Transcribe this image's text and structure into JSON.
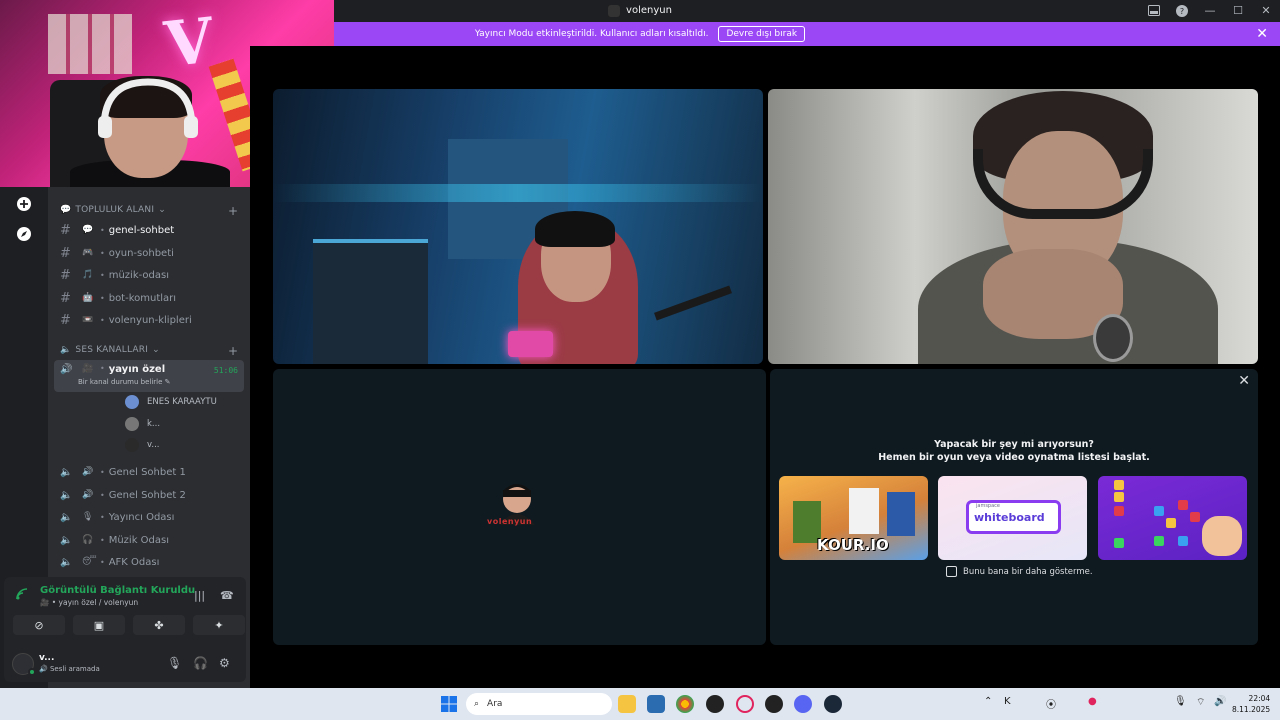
{
  "window": {
    "title": "volenyun"
  },
  "notice": {
    "text": "Yayıncı Modu etkinleştirildi. Kullanıcı adları kısaltıldı.",
    "button": "Devre dışı bırak"
  },
  "sidebar": {
    "text_category": "TOPLULUK ALANI",
    "text_channels": [
      {
        "emoji": "💬",
        "name": "genel-sohbet",
        "active": true
      },
      {
        "emoji": "🎮",
        "name": "oyun-sohbeti",
        "active": false
      },
      {
        "emoji": "🎵",
        "name": "müzik-odası",
        "active": false
      },
      {
        "emoji": "🤖",
        "name": "bot-komutları",
        "active": false
      },
      {
        "emoji": "📼",
        "name": "volenyun-klipleri",
        "active": false
      }
    ],
    "voice_category": "SES KANALLARI",
    "selected_voice": {
      "name": "yayın özel",
      "timer": "51:06",
      "status_prompt": "Bir kanal durumu belirle"
    },
    "voice_users": [
      {
        "name": "ENES KARAAYTU",
        "camera": true
      },
      {
        "name": "k...",
        "camera": true
      },
      {
        "name": "v...",
        "camera": false
      }
    ],
    "voice_channels": [
      {
        "name": "Genel Sohbet 1"
      },
      {
        "name": "Genel Sohbet 2"
      },
      {
        "name": "Yayıncı Odası"
      },
      {
        "name": "Müzik Odası"
      },
      {
        "name": "AFK Odası"
      }
    ]
  },
  "voice_panel": {
    "state": "Görüntülü Bağlantı Kuruldu",
    "channel": "yayın özel / volenyun"
  },
  "user": {
    "name": "v...",
    "status": "Sesli aramada"
  },
  "activity": {
    "line1": "Yapacak bir şey mi arıyorsun?",
    "line2": "Hemen bir oyun veya video oynatma listesi başlat.",
    "games": [
      {
        "label": "KOUR.IO"
      },
      {
        "small": "jamspace",
        "label": "whiteboard"
      },
      {
        "label": ""
      }
    ],
    "dont_show": "Bunu bana bir daha gösterme."
  },
  "tile3": {
    "logo_text": "volenyun"
  },
  "taskbar": {
    "search": "Ara",
    "time": "22:04",
    "date": "8.11.2025"
  }
}
